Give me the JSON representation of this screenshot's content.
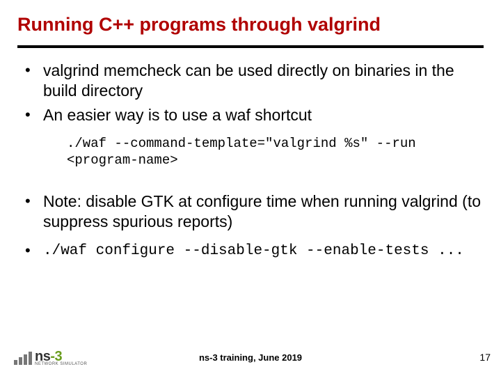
{
  "slide": {
    "title": "Running C++ programs through valgrind",
    "bullets": {
      "b1": "valgrind memcheck can be used directly on binaries in the build directory",
      "b2": "An easier way is to use a waf shortcut",
      "b3": "Note: disable GTK at configure time when running valgrind (to suppress spurious reports)"
    },
    "code1": {
      "line1": "./waf --command-template=\"valgrind %s\" --run",
      "line2": "<program-name>"
    },
    "code2": "./waf configure --disable-gtk --enable-tests ...",
    "footer": "ns-3 training, June 2019",
    "page": "17",
    "logo": {
      "prefix": "ns",
      "suffix": "-3",
      "sub": "NETWORK SIMULATOR"
    }
  }
}
